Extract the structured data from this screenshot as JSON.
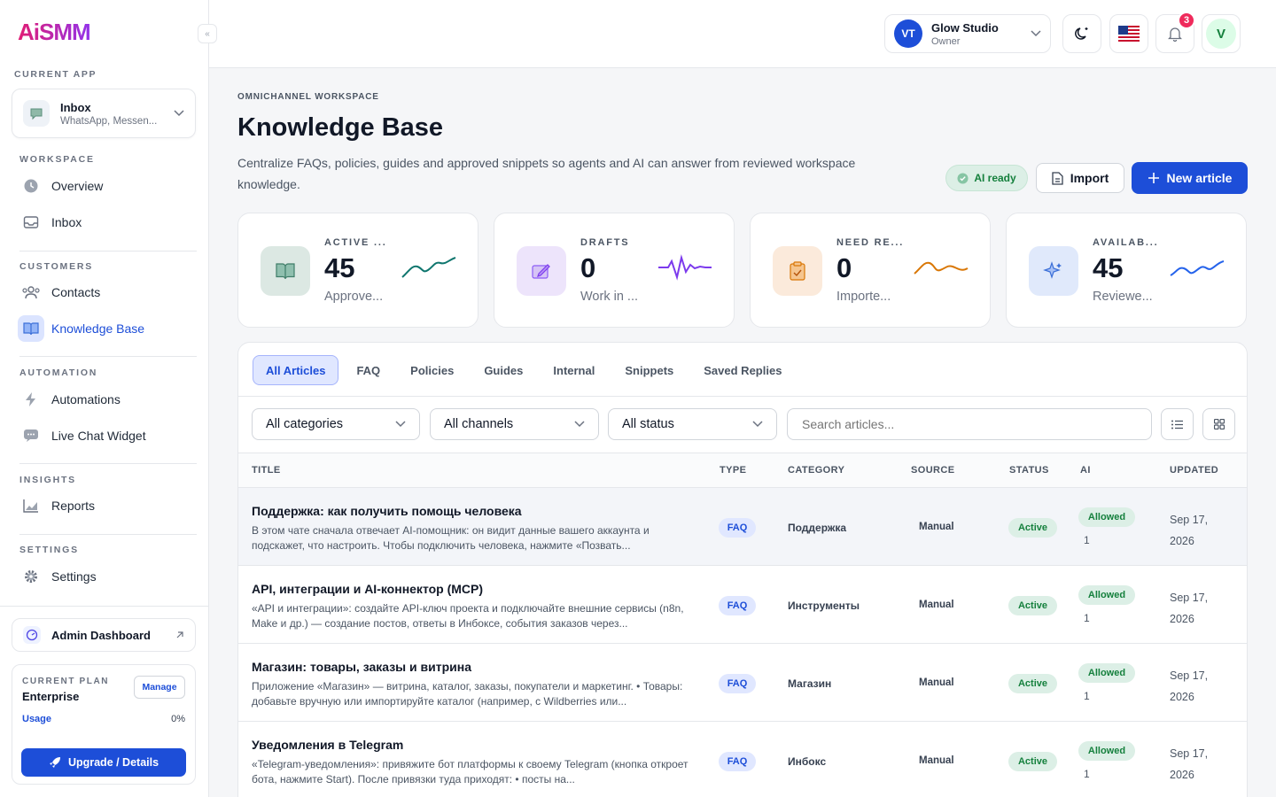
{
  "brand": {
    "logo_text": "AiSMM"
  },
  "sidebar": {
    "current_app_label": "CURRENT APP",
    "current_app": {
      "title": "Inbox",
      "subtitle": "WhatsApp, Messen..."
    },
    "sections": {
      "workspace": "WORKSPACE",
      "customers": "CUSTOMERS",
      "automation": "AUTOMATION",
      "insights": "INSIGHTS",
      "settings": "SETTINGS"
    },
    "items": {
      "overview": "Overview",
      "inbox": "Inbox",
      "contacts": "Contacts",
      "knowledge_base": "Knowledge Base",
      "automations": "Automations",
      "live_chat": "Live Chat Widget",
      "reports": "Reports",
      "settings": "Settings"
    },
    "admin_dashboard": "Admin Dashboard",
    "plan": {
      "label": "CURRENT PLAN",
      "name": "Enterprise",
      "manage": "Manage",
      "usage_label": "Usage",
      "usage_value": "0%",
      "upgrade": "Upgrade / Details"
    }
  },
  "topbar": {
    "workspace": {
      "initials": "VT",
      "name": "Glow Studio",
      "role": "Owner"
    },
    "notifications_count": "3",
    "user_initial": "V"
  },
  "page": {
    "eyebrow": "OMNICHANNEL WORKSPACE",
    "title": "Knowledge Base",
    "description": "Centralize FAQs, policies, guides and approved snippets so agents and AI can answer from reviewed workspace knowledge.",
    "ai_ready": "AI ready",
    "import": "Import",
    "new_article": "New article"
  },
  "stats": [
    {
      "label": "ACTIVE ...",
      "value": "45",
      "sub": "Approve...",
      "color": "#0f766e"
    },
    {
      "label": "DRAFTS",
      "value": "0",
      "sub": "Work in ...",
      "color": "#7c3aed"
    },
    {
      "label": "NEED RE...",
      "value": "0",
      "sub": "Importe...",
      "color": "#d97706"
    },
    {
      "label": "AVAILAB...",
      "value": "45",
      "sub": "Reviewe...",
      "color": "#2563eb"
    }
  ],
  "tabs": [
    "All Articles",
    "FAQ",
    "Policies",
    "Guides",
    "Internal",
    "Snippets",
    "Saved Replies"
  ],
  "filters": {
    "categories": "All categories",
    "channels": "All channels",
    "status": "All status",
    "search_placeholder": "Search articles..."
  },
  "table": {
    "headers": [
      "TITLE",
      "TYPE",
      "CATEGORY",
      "SOURCE",
      "STATUS",
      "AI",
      "UPDATED"
    ],
    "rows": [
      {
        "title": "Поддержка: как получить помощь человека",
        "excerpt": "В этом чате сначала отвечает AI-помощник: он видит данные вашего аккаунта и подскажет, что настроить. Чтобы подключить человека, нажмите «Позвать...",
        "type": "FAQ",
        "category": "Поддержка",
        "source": "Manual",
        "status": "Active",
        "ai": "Allowed",
        "ai_count": "1",
        "updated": "Sep 17, 2026"
      },
      {
        "title": "API, интеграции и AI-коннектор (MCP)",
        "excerpt": "«API и интеграции»: создайте API-ключ проекта и подключайте внешние сервисы (n8n, Make и др.) — создание постов, ответы в Инбоксе, события заказов через...",
        "type": "FAQ",
        "category": "Инструменты",
        "source": "Manual",
        "status": "Active",
        "ai": "Allowed",
        "ai_count": "1",
        "updated": "Sep 17, 2026"
      },
      {
        "title": "Магазин: товары, заказы и витрина",
        "excerpt": "Приложение «Магазин» — витрина, каталог, заказы, покупатели и маркетинг. • Товары: добавьте вручную или импортируйте каталог (например, с Wildberries или...",
        "type": "FAQ",
        "category": "Магазин",
        "source": "Manual",
        "status": "Active",
        "ai": "Allowed",
        "ai_count": "1",
        "updated": "Sep 17, 2026"
      },
      {
        "title": "Уведомления в Telegram",
        "excerpt": "«Telegram-уведомления»: привяжите бот платформы к своему Telegram (кнопка откроет бота, нажмите Start). После привязки туда приходят: • посты на...",
        "type": "FAQ",
        "category": "Инбокс",
        "source": "Manual",
        "status": "Active",
        "ai": "Allowed",
        "ai_count": "1",
        "updated": "Sep 17, 2026"
      }
    ]
  }
}
